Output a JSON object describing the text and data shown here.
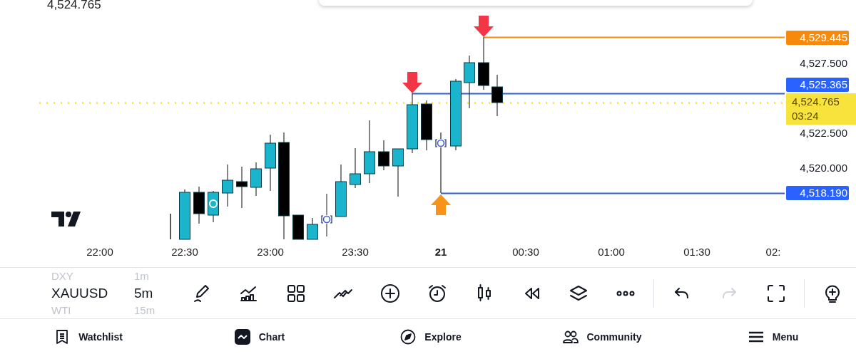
{
  "header": {
    "price": "4,524.765"
  },
  "price_axis": [
    {
      "kind": "marker",
      "label": "4,529.445",
      "color": "#f7890c"
    },
    {
      "kind": "tick",
      "label": "4,527.500"
    },
    {
      "kind": "marker",
      "label": "4,525.365",
      "color": "#2962ff"
    },
    {
      "kind": "current",
      "label": "4,524.765",
      "countdown": "03:24"
    },
    {
      "kind": "tick",
      "label": "4,522.500"
    },
    {
      "kind": "tick",
      "label": "4,520.000"
    },
    {
      "kind": "marker",
      "label": "4,518.190",
      "color": "#2962ff"
    }
  ],
  "time_axis": [
    {
      "label": "22:00",
      "bold": false
    },
    {
      "label": "22:30",
      "bold": false
    },
    {
      "label": "23:00",
      "bold": false
    },
    {
      "label": "23:30",
      "bold": false
    },
    {
      "label": "21",
      "bold": true
    },
    {
      "label": "00:30",
      "bold": false
    },
    {
      "label": "01:00",
      "bold": false
    },
    {
      "label": "01:30",
      "bold": false
    },
    {
      "label": "02:",
      "bold": false
    }
  ],
  "symbols": [
    {
      "symbol": "DXY",
      "interval": "1m",
      "selected": false
    },
    {
      "symbol": "XAUUSD",
      "interval": "5m",
      "selected": true
    },
    {
      "symbol": "WTI",
      "interval": "15m",
      "selected": false
    }
  ],
  "tools": [
    {
      "kind": "draw",
      "disabled": false
    },
    {
      "kind": "indicators",
      "disabled": false
    },
    {
      "kind": "layout",
      "disabled": false
    },
    {
      "kind": "templates",
      "disabled": false
    },
    {
      "kind": "add",
      "disabled": false
    },
    {
      "kind": "alert",
      "disabled": false
    },
    {
      "kind": "chart-type",
      "disabled": false
    },
    {
      "kind": "replay",
      "disabled": false
    },
    {
      "kind": "layers",
      "disabled": false
    },
    {
      "kind": "more",
      "disabled": false
    },
    {
      "kind": "divider"
    },
    {
      "kind": "undo",
      "disabled": false
    },
    {
      "kind": "redo",
      "disabled": true
    },
    {
      "kind": "fullscreen",
      "disabled": false
    },
    {
      "kind": "divider"
    },
    {
      "kind": "ideas",
      "disabled": false
    }
  ],
  "nav": [
    {
      "kind": "watchlist",
      "label": "Watchlist",
      "selected": false
    },
    {
      "kind": "chart",
      "label": "Chart",
      "selected": true
    },
    {
      "kind": "explore",
      "label": "Explore",
      "selected": false
    },
    {
      "kind": "community",
      "label": "Community",
      "selected": false
    },
    {
      "kind": "menu",
      "label": "Menu",
      "selected": false
    }
  ]
}
